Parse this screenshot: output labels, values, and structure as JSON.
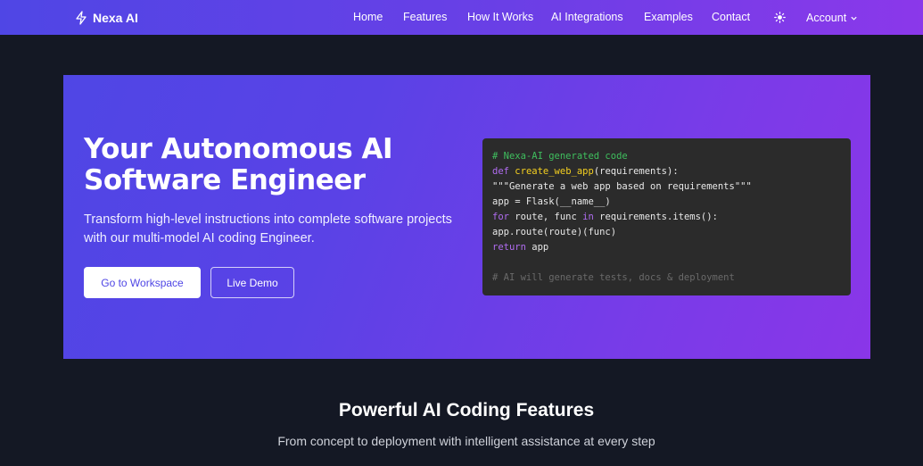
{
  "nav": {
    "brand": "Nexa AI",
    "links": [
      "Home",
      "Features",
      "How It Works",
      "AI Integrations",
      "Examples",
      "Contact"
    ],
    "account": "Account",
    "icons": {
      "logo": "lightning-bolt-icon",
      "theme": "sun-icon",
      "account": "chevron-down-icon"
    }
  },
  "hero": {
    "title": "Your Autonomous AI Software Engineer",
    "subtitle": "Transform high-level instructions into complete software projects with our multi-model AI coding Engineer.",
    "primary_button": "Go to Workspace",
    "secondary_button": "Live Demo",
    "code": {
      "comment": "# Nexa-AI generated code",
      "line2_kw": "def",
      "line2_fn": "create_web_app",
      "line2_rest": "(requirements):",
      "line3": "\"\"\"Generate a web app based on requirements\"\"\"",
      "line4": "app = Flask(__name__)",
      "line5_kw1": "for",
      "line5_mid": " route, func ",
      "line5_kw2": "in",
      "line5_rest": " requirements.items():",
      "line6": "app.route(route)(func)",
      "line7_kw": "return",
      "line7_rest": " app",
      "line9": "# AI will generate tests, docs & deployment"
    }
  },
  "features": {
    "title": "Powerful AI Coding Features",
    "subtitle": "From concept to deployment with intelligent assistance at every step"
  },
  "colors": {
    "nav_start": "#4f46e5",
    "nav_end": "#8b38ea",
    "page_bg": "#141824",
    "code_bg": "#2b2b2b",
    "accent": "#4f46e5"
  }
}
